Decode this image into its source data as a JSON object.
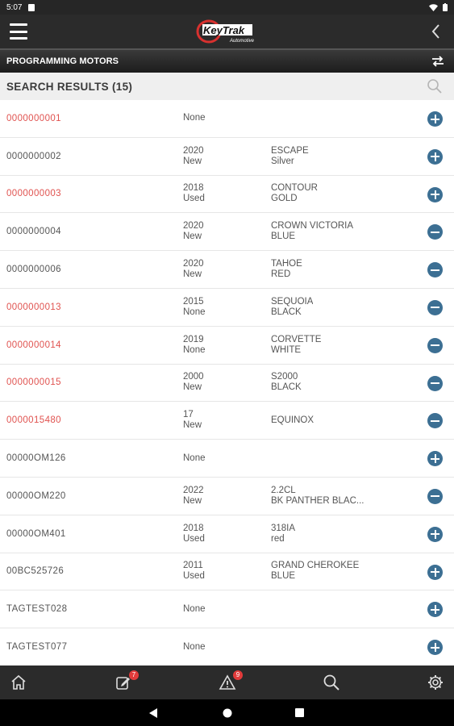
{
  "status_bar": {
    "time": "5:07"
  },
  "app": {
    "logo_text": "KeyTrak",
    "logo_sub": "Automotive"
  },
  "subheader": {
    "title": "PROGRAMMING MOTORS"
  },
  "search": {
    "title": "SEARCH RESULTS (15)"
  },
  "results": [
    {
      "id": "0000000001",
      "red": true,
      "year": "None",
      "condition": "",
      "model": "",
      "color": "",
      "action": "add"
    },
    {
      "id": "0000000002",
      "red": false,
      "year": "2020",
      "condition": "New",
      "model": "ESCAPE",
      "color": "Silver",
      "action": "add"
    },
    {
      "id": "0000000003",
      "red": true,
      "year": "2018",
      "condition": "Used",
      "model": "CONTOUR",
      "color": "GOLD",
      "action": "add"
    },
    {
      "id": "0000000004",
      "red": false,
      "year": "2020",
      "condition": "New",
      "model": "CROWN VICTORIA",
      "color": "BLUE",
      "action": "remove"
    },
    {
      "id": "0000000006",
      "red": false,
      "year": "2020",
      "condition": "New",
      "model": "TAHOE",
      "color": "RED",
      "action": "remove"
    },
    {
      "id": "0000000013",
      "red": true,
      "year": "2015",
      "condition": "None",
      "model": "SEQUOIA",
      "color": "BLACK",
      "action": "remove"
    },
    {
      "id": "0000000014",
      "red": true,
      "year": "2019",
      "condition": "None",
      "model": "CORVETTE",
      "color": "WHITE",
      "action": "remove"
    },
    {
      "id": "0000000015",
      "red": true,
      "year": "2000",
      "condition": "New",
      "model": "S2000",
      "color": "BLACK",
      "action": "remove"
    },
    {
      "id": "0000015480",
      "red": true,
      "year": "17",
      "condition": "New",
      "model": "EQUINOX",
      "color": "",
      "action": "remove"
    },
    {
      "id": "00000OM126",
      "red": false,
      "year": "None",
      "condition": "",
      "model": "",
      "color": "",
      "action": "add"
    },
    {
      "id": "00000OM220",
      "red": false,
      "year": "2022",
      "condition": "New",
      "model": "2.2CL",
      "color": "BK PANTHER BLAC...",
      "action": "remove"
    },
    {
      "id": "00000OM401",
      "red": false,
      "year": "2018",
      "condition": "Used",
      "model": "318IA",
      "color": "red",
      "action": "add"
    },
    {
      "id": "00BC525726",
      "red": false,
      "year": "2011",
      "condition": "Used",
      "model": "GRAND CHEROKEE",
      "color": "BLUE",
      "action": "add"
    },
    {
      "id": "TAGTEST028",
      "red": false,
      "year": "None",
      "condition": "",
      "model": "",
      "color": "",
      "action": "add"
    },
    {
      "id": "TAGTEST077",
      "red": false,
      "year": "None",
      "condition": "",
      "model": "",
      "color": "",
      "action": "add"
    }
  ],
  "bottom_nav": {
    "items": [
      {
        "icon": "home-icon"
      },
      {
        "icon": "edit-icon",
        "badge": "7"
      },
      {
        "icon": "alert-icon",
        "badge": "9"
      },
      {
        "icon": "search-icon"
      },
      {
        "icon": "gear-icon"
      }
    ]
  },
  "colors": {
    "red_id": "#e0524f",
    "action_blue": "#3c6f93",
    "header_dark": "#2b2b2b"
  }
}
